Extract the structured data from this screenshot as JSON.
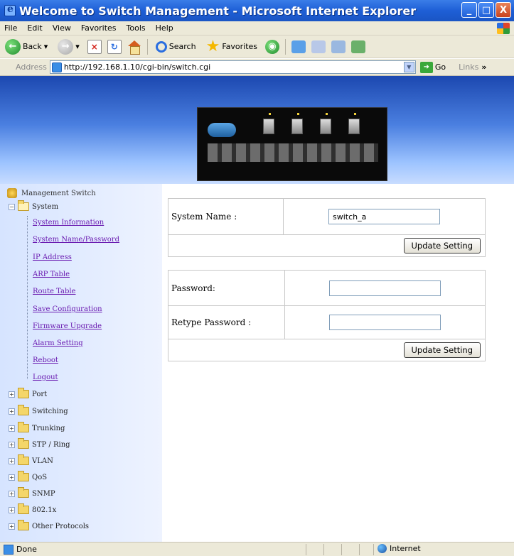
{
  "window": {
    "title": "Welcome to Switch Management - Microsoft Internet Explorer",
    "controls": [
      "_",
      "□",
      "X"
    ]
  },
  "menu": [
    "File",
    "Edit",
    "View",
    "Favorites",
    "Tools",
    "Help"
  ],
  "toolbar": {
    "back_label": "Back",
    "search_label": "Search",
    "favorites_label": "Favorites"
  },
  "address": {
    "label": "Address",
    "url": "http://192.168.1.10/cgi-bin/switch.cgi",
    "go_label": "Go",
    "links_label": "Links"
  },
  "tree": {
    "root": "Management Switch",
    "system": "System",
    "system_links": [
      "System Information",
      "System Name/Password",
      "IP Address",
      "ARP Table",
      "Route Table",
      "Save Configuration",
      "Firmware Upgrade",
      "Alarm Setting",
      "Reboot",
      "Logout"
    ],
    "folders": [
      "Port",
      "Switching",
      "Trunking",
      "STP / Ring",
      "VLAN",
      "QoS",
      "SNMP",
      "802.1x",
      "Other Protocols"
    ]
  },
  "form_name": {
    "label": "System Name :",
    "value": "switch_a",
    "button": "Update Setting"
  },
  "form_password": {
    "password_label": "Password:",
    "password_value": "",
    "retype_label": "Retype Password :",
    "retype_value": "",
    "button": "Update Setting"
  },
  "status": {
    "text": "Done",
    "zone": "Internet"
  },
  "colors": {
    "titlebar": "#1e5fd6",
    "link_visited": "#6a1bb1",
    "tree_bg": "#d6e4ff"
  }
}
